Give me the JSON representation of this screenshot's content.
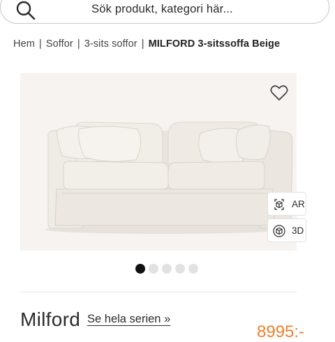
{
  "search": {
    "placeholder": "Sök produkt, kategori här...",
    "icon": "search-icon"
  },
  "breadcrumb": {
    "items": [
      "Hem",
      "Soffor",
      "3-sits soffor"
    ],
    "current": "MILFORD 3-sitssoffa Beige",
    "separator": "|"
  },
  "gallery": {
    "favorite_icon": "heart-icon",
    "ar_label": "AR",
    "threed_label": "3D",
    "slide_count": 5,
    "active_slide": 1
  },
  "product": {
    "name": "Milford",
    "series_link": "Se hela serien »",
    "price": "8995:-"
  },
  "colors": {
    "accent_price": "#f07f2a",
    "sofa_fabric": "#ece7e0",
    "gallery_bg": "#f6f3f1",
    "dot_active": "#111111",
    "dot_inactive": "#e2e2e2"
  }
}
